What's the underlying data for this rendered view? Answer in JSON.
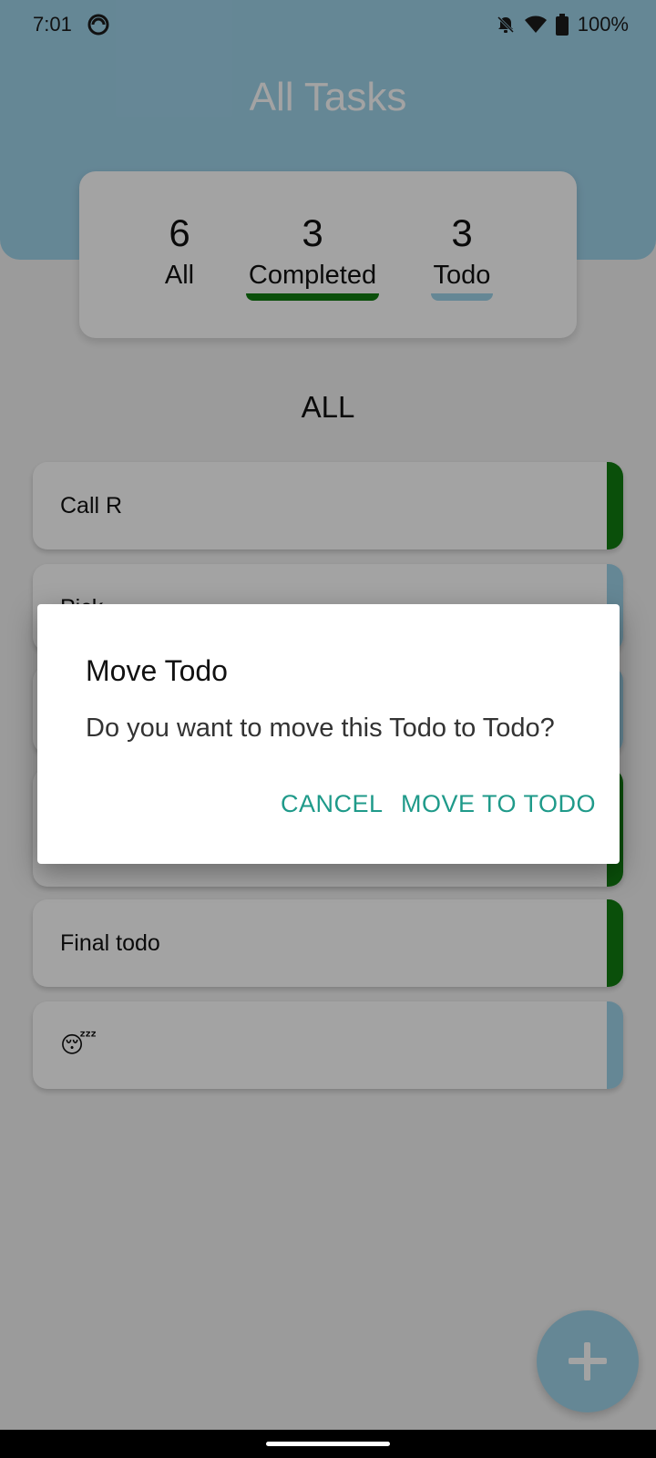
{
  "status": {
    "time": "7:01",
    "battery": "100%"
  },
  "header": {
    "title": "All Tasks"
  },
  "summary": [
    {
      "count": "6",
      "label": "All"
    },
    {
      "count": "3",
      "label": "Completed",
      "underline": "#107c10"
    },
    {
      "count": "3",
      "label": "Todo",
      "underline": "#9fd3ea"
    }
  ],
  "filter": {
    "title": "ALL"
  },
  "tasks": [
    {
      "label": "Call R",
      "status_color": "#107c10"
    },
    {
      "label": "Pick...",
      "status_color": "#9fd3ea"
    },
    {
      "label": "",
      "status_color": "#9fd3ea"
    },
    {
      "label": "",
      "status_color": "#107c10"
    },
    {
      "label": "Final todo",
      "status_color": "#107c10"
    },
    {
      "label": "😴",
      "status_color": "#9fd3ea"
    }
  ],
  "fab": {
    "icon": "plus-icon"
  },
  "dialog": {
    "title": "Move Todo",
    "message": "Do you want to move this Todo to Todo?",
    "cancel_label": "CANCEL",
    "confirm_label": "MOVE TO TODO"
  },
  "colors": {
    "accent": "#9fd3ea",
    "done": "#107c10",
    "button_text": "#1f9a8a"
  }
}
